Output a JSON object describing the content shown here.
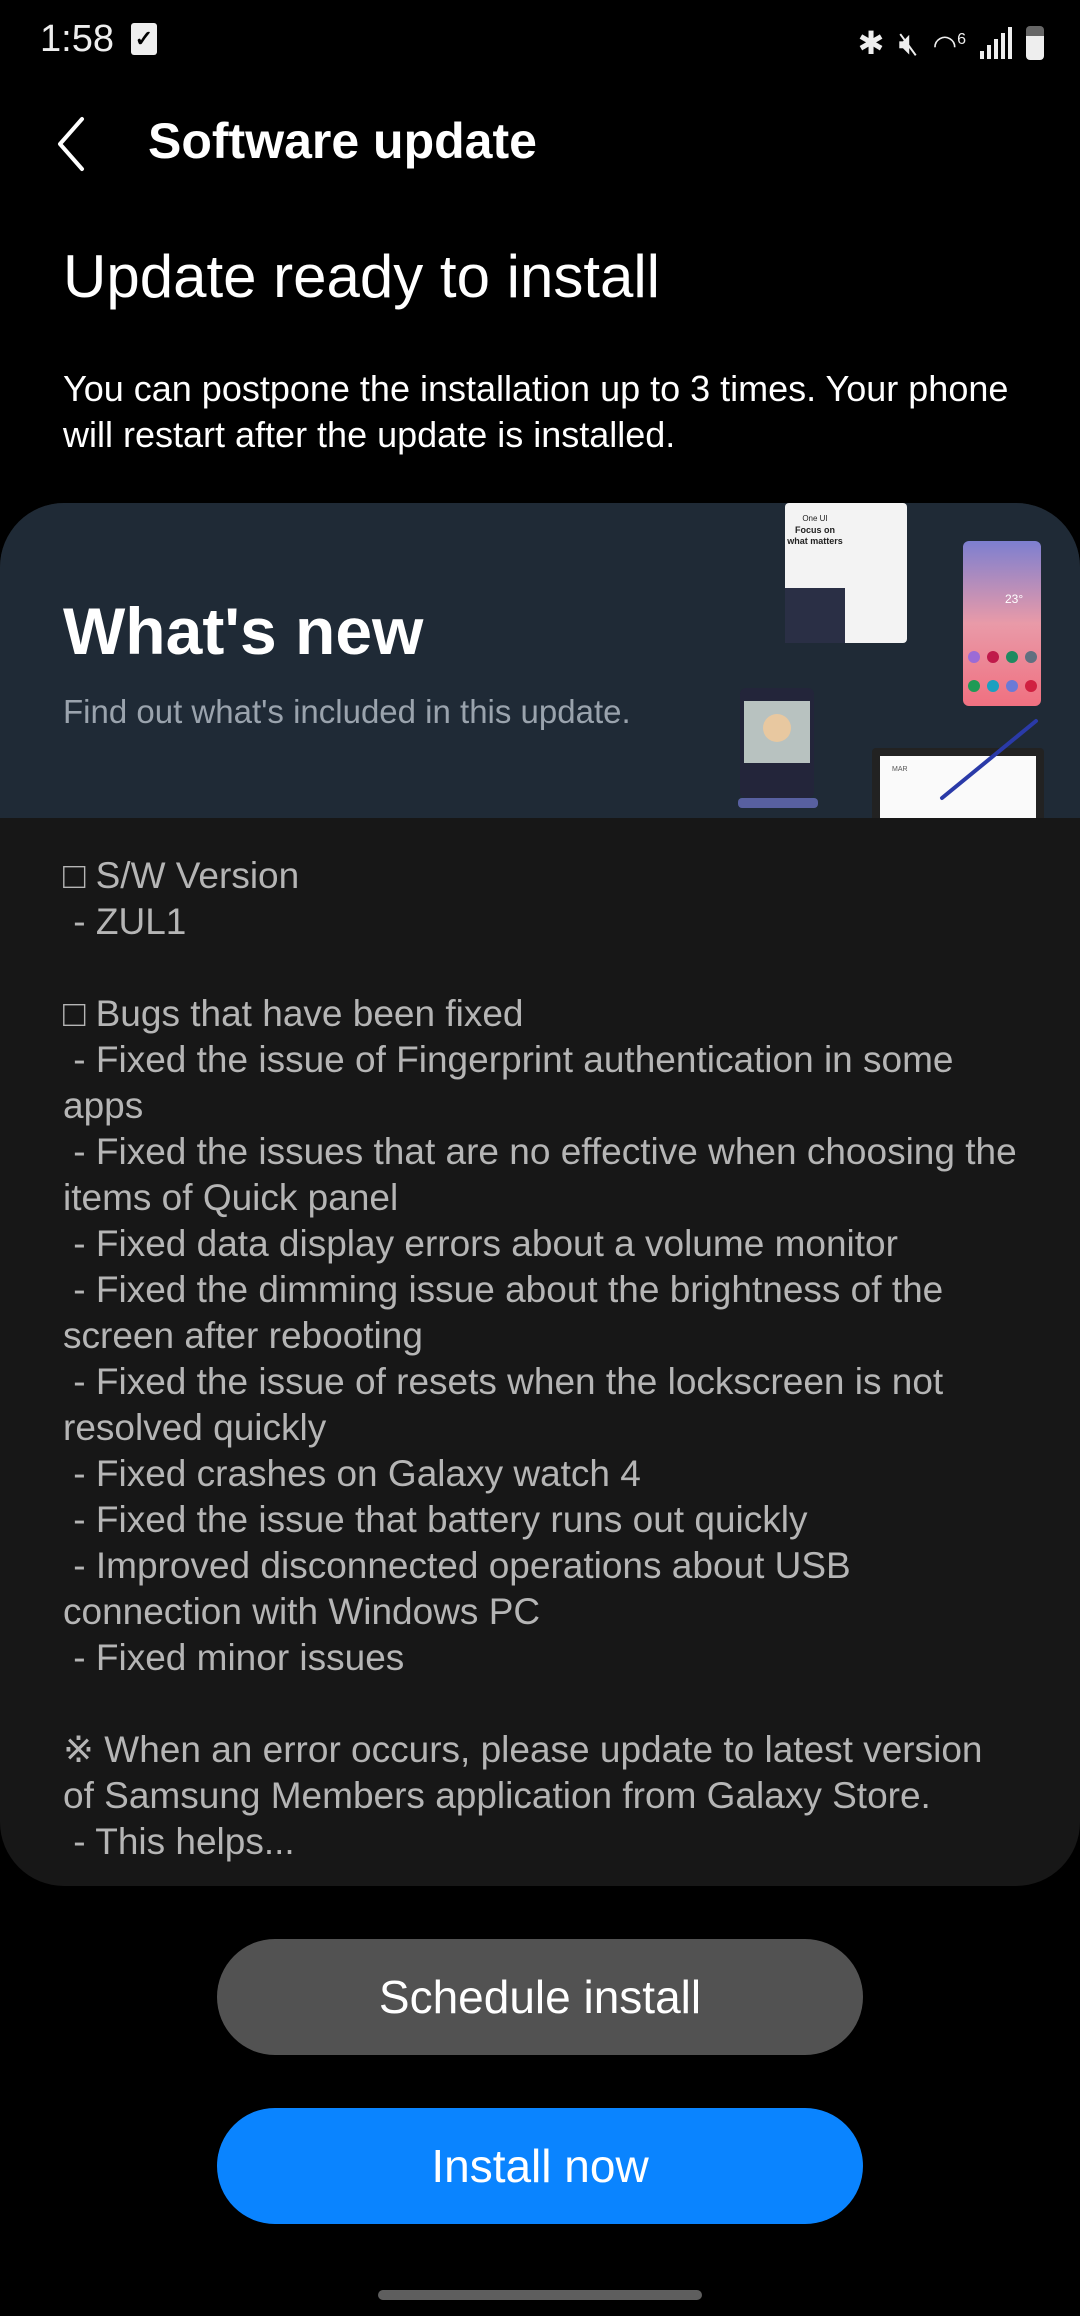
{
  "status_bar": {
    "time": "1:58",
    "notification_icon": "checkbox-icon",
    "icons": [
      "bluetooth-icon",
      "mute-icon",
      "wifi-6-icon",
      "signal-icon",
      "battery-icon"
    ],
    "wifi_label": "6"
  },
  "app_bar": {
    "back_icon": "chevron-left-icon",
    "title": "Software update"
  },
  "main": {
    "headline": "Update ready to install",
    "description": "You can postpone the installation up to 3 times. Your phone will restart after the update is installed."
  },
  "whats_new": {
    "title": "What's new",
    "subtitle": "Find out what's included in this update.",
    "illustration": "galaxy-devices-illustration",
    "illustration_text": {
      "brand": "One UI",
      "headline": "Focus on what matters",
      "weather": "23°",
      "calendar_month": "MAR"
    }
  },
  "release_notes": [
    "□ S/W Version",
    " - ZUL1",
    "",
    "□ Bugs that have been fixed",
    " - Fixed the issue of Fingerprint authentication in some apps",
    " - Fixed the issues that are no effective when choosing the items of Quick panel",
    " - Fixed data display errors about a volume monitor",
    " - Fixed the dimming issue about the brightness of the screen after rebooting",
    " - Fixed the issue of resets when the lockscreen is not resolved quickly",
    " - Fixed crashes on Galaxy watch 4",
    " - Fixed the issue that battery runs out quickly",
    " - Improved disconnected operations about USB connection with Windows PC",
    " - Fixed minor issues",
    "",
    "※ When an error occurs, please update to latest version of Samsung Members application from Galaxy Store.",
    " - This helps..."
  ],
  "buttons": {
    "schedule": "Schedule install",
    "install": "Install now"
  },
  "colors": {
    "accent": "#0a84ff",
    "secondary_button": "#525252",
    "banner_bg": "#1f2a36",
    "card_bg": "#171717"
  }
}
